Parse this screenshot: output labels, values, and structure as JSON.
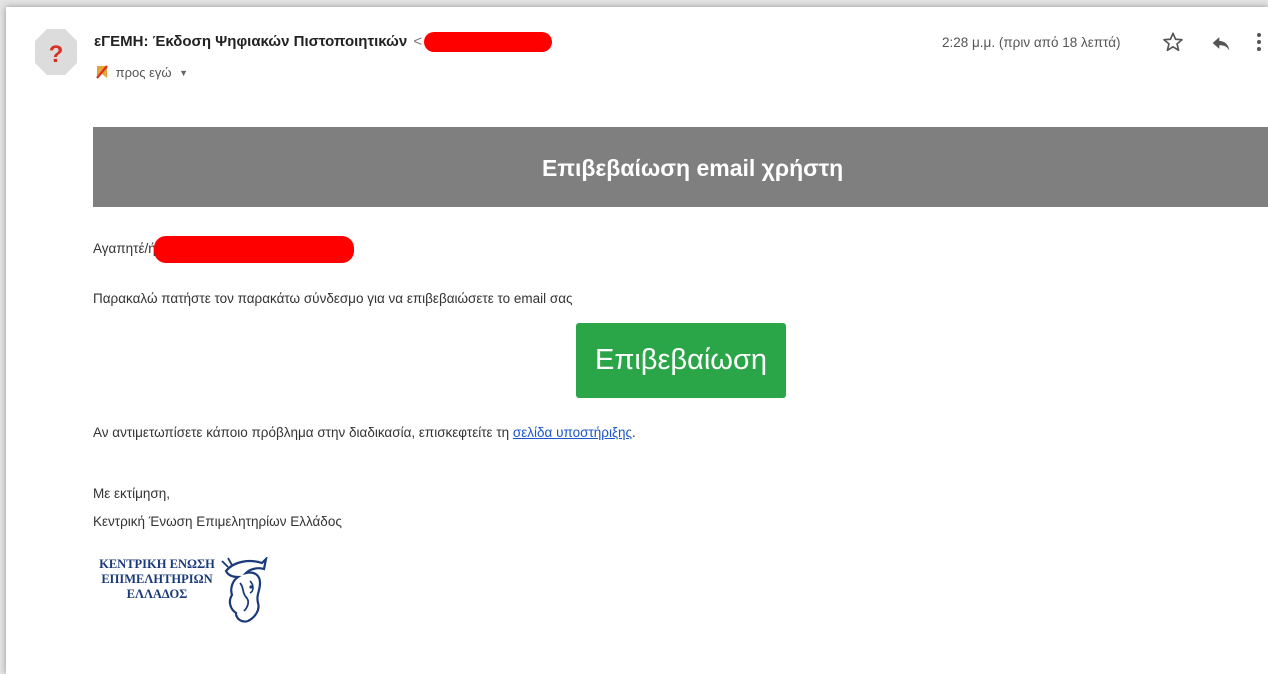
{
  "email": {
    "sender_avatar_glyph": "?",
    "subject": "εΓΕΜΗ: Έκδοση Ψηφιακών Πιστοποιητικών",
    "sender_email_prefix": "<",
    "recipient_label": "προς εγώ",
    "timestamp": "2:28 μ.μ. (πριν από 18 λεπτά)",
    "icons": {
      "avatar": "unknown-sender-icon",
      "label": "important-label-icon",
      "star": "star-icon",
      "reply": "reply-icon",
      "more": "more-vertical-icon",
      "recipient_caret": "caret-down-icon"
    }
  },
  "message": {
    "banner_title": "Επιβεβαίωση email χρήστη",
    "greeting": "Αγαπητέ/ή",
    "instruction": "Παρακαλώ πατήστε τον παρακάτω σύνδεσμο για να επιβεβαιώσετε το email σας",
    "confirm_button": "Επιβεβαίωση",
    "problem_prefix": "Αν αντιμετωπίσετε κάποιο πρόβλημα στην διαδικασία, επισκεφτείτε τη ",
    "support_link": "σελίδα υποστήριξης",
    "problem_suffix": ".",
    "regards": "Με εκτίμηση,",
    "signature": "Κεντρική Ένωση Επιμελητηρίων Ελλάδος",
    "logo_lines": [
      "ΚΕΝΤΡΙΚΗ ΕΝΩΣΗ",
      "ΕΠΙΜΕΛΗΤΗΡΙΩΝ",
      "ΕΛΛΑΔΟΣ"
    ]
  },
  "colors": {
    "banner": "#7f7f7f",
    "button": "#2aa648",
    "link": "#1a55c9",
    "redaction": "#ff0000",
    "avatar": "#dcdcdc",
    "avatar_glyph": "#d93025"
  }
}
